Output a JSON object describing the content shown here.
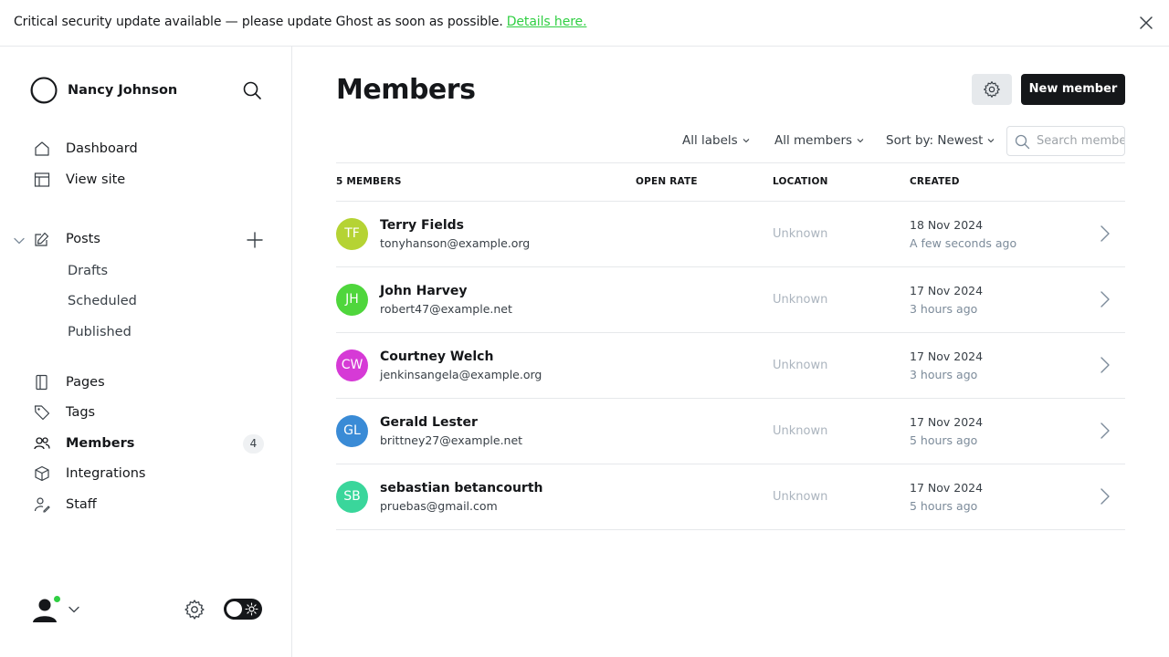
{
  "banner": {
    "text": "Critical security update available — please update Ghost as soon as possible.",
    "link": "Details here."
  },
  "sidebar": {
    "site_name": "Nancy Johnson",
    "nav": {
      "dashboard": "Dashboard",
      "view_site": "View site",
      "posts": "Posts",
      "drafts": "Drafts",
      "scheduled": "Scheduled",
      "published": "Published",
      "pages": "Pages",
      "tags": "Tags",
      "members": "Members",
      "members_count": "4",
      "integrations": "Integrations",
      "staff": "Staff"
    }
  },
  "main": {
    "title": "Members",
    "new_member_label": "New member",
    "filters": {
      "labels": "All labels",
      "members": "All members",
      "sort": "Sort by: Newest"
    },
    "search_placeholder": "Search members...",
    "columns": {
      "members": "5 MEMBERS",
      "open_rate": "OPEN RATE",
      "location": "LOCATION",
      "created": "CREATED"
    },
    "rows": [
      {
        "initials": "TF",
        "name": "Terry Fields",
        "email": "tonyhanson@example.org",
        "location": "Unknown",
        "date": "18 Nov 2024",
        "relative": "A few seconds ago",
        "color": "#b5d334"
      },
      {
        "initials": "JH",
        "name": "John Harvey",
        "email": "robert47@example.net",
        "location": "Unknown",
        "date": "17 Nov 2024",
        "relative": "3 hours ago",
        "color": "#4fd63c"
      },
      {
        "initials": "CW",
        "name": "Courtney Welch",
        "email": "jenkinsangela@example.org",
        "location": "Unknown",
        "date": "17 Nov 2024",
        "relative": "3 hours ago",
        "color": "#d63ad6"
      },
      {
        "initials": "GL",
        "name": "Gerald Lester",
        "email": "brittney27@example.net",
        "location": "Unknown",
        "date": "17 Nov 2024",
        "relative": "5 hours ago",
        "color": "#3a8bd6"
      },
      {
        "initials": "SB",
        "name": "sebastian betancourth",
        "email": "pruebas@gmail.com",
        "location": "Unknown",
        "date": "17 Nov 2024",
        "relative": "5 hours ago",
        "color": "#3ad69b"
      }
    ]
  },
  "colors": {
    "accent_green": "#30cf43",
    "dark": "#15171a",
    "border": "#e6e8eb"
  }
}
